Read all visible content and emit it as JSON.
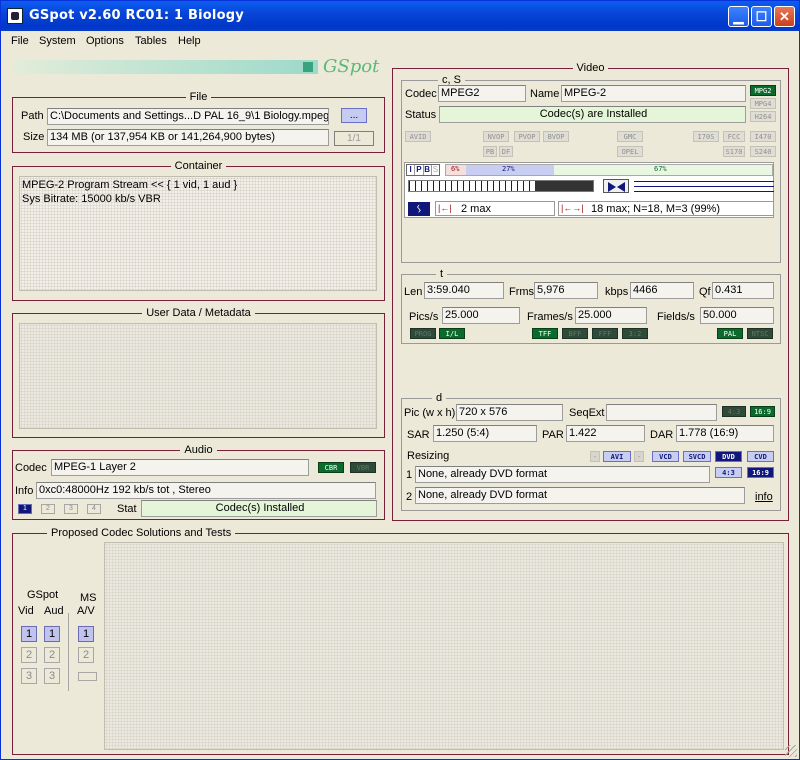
{
  "window": {
    "title": "GSpot v2.60 RC01: 1 Biology"
  },
  "menu": [
    "File",
    "System",
    "Options",
    "Tables",
    "Help"
  ],
  "logo": {
    "text": "GSpot"
  },
  "file": {
    "legend": "File",
    "path_label": "Path",
    "path_value": "C:\\Documents and Settings...D PAL 16_9\\1 Biology.mpeg",
    "browse_label": "...",
    "size_label": "Size",
    "size_value": "134 MB (or 137,954 KB or 141,264,900 bytes)",
    "page": "1/1"
  },
  "container": {
    "legend": "Container",
    "line1": "MPEG-2 Program Stream << { 1 vid, 1 aud }",
    "line2": "Sys Bitrate: 15000 kb/s VBR"
  },
  "userdata": {
    "legend": "User Data / Metadata"
  },
  "audio": {
    "legend": "Audio",
    "codec_label": "Codec",
    "codec_value": "MPEG-1 Layer 2",
    "cbr": "CBR",
    "vbr": "VBR",
    "info_label": "Info",
    "info_value": "0xc0:48000Hz  192 kb/s tot , Stereo",
    "tabs": [
      "1",
      "2",
      "3",
      "4"
    ],
    "stat_label": "Stat",
    "stat_value": "Codec(s) Installed"
  },
  "video": {
    "legend": "Video",
    "cs_legend": "c, S",
    "codec_label": "Codec",
    "codec_value": "MPEG2",
    "name_label": "Name",
    "name_value": "MPEG-2",
    "status_label": "Status",
    "status_value": "Codec(s) are Installed",
    "format_chips": [
      "MPG2",
      "MPG4",
      "H264"
    ],
    "flag_chips": [
      "AVID",
      "NVOP",
      "PVOP",
      "BVOP",
      "GMC",
      "I70S",
      "FCC",
      "I470",
      "PB",
      "DF",
      "OPEL",
      "S170",
      "S240"
    ],
    "frame_types": [
      "I",
      "P",
      "B",
      "S"
    ],
    "pct_i": "6%",
    "pct_p": "27%",
    "pct_b": "67%",
    "bp_label": "2 max",
    "gop_label": "18 max; N=18, M=3 (99%)",
    "t_legend": "t",
    "len_label": "Len",
    "len_value": "3:59.040",
    "frms_label": "Frms",
    "frms_value": "5,976",
    "kbps_label": "kbps",
    "kbps_value": "4466",
    "qf_label": "Qf",
    "qf_value": "0.431",
    "pics_label": "Pics/s",
    "pics_value": "25.000",
    "frames_label": "Frames/s",
    "frames_value": "25.000",
    "fields_label": "Fields/s",
    "fields_value": "50.000",
    "scan_chips": [
      "PROG",
      "I/L",
      "TFF",
      "BFF",
      "FFF",
      "3:2",
      "PAL",
      "NTSC"
    ],
    "d_legend": "d",
    "pic_label": "Pic (w x h)",
    "pic_value": "720 x 576",
    "seqext_label": "SeqExt",
    "aspect_chips": [
      "4:3",
      "16:9"
    ],
    "sar_label": "SAR",
    "sar_value": "1.250 (5:4)",
    "par_label": "PAR",
    "par_value": "1.422",
    "dar_label": "DAR",
    "dar_value": "1.778 (16:9)",
    "resizing_label": "Resizing",
    "resize_chips": [
      "AVI",
      "VCD",
      "SVCD",
      "DVD",
      "CVD"
    ],
    "resize_aspect": [
      "4:3",
      "16:9"
    ],
    "row1_num": "1",
    "row1_value": "None, already DVD format",
    "row2_num": "2",
    "row2_value": "None, already DVD format",
    "info_link": "info"
  },
  "proposed": {
    "legend": "Proposed Codec Solutions and Tests",
    "gspot_label": "GSpot",
    "vid_label": "Vid",
    "aud_label": "Aud",
    "ms_label": "MS",
    "av_label": "A/V",
    "nums": [
      "1",
      "2",
      "3"
    ]
  }
}
